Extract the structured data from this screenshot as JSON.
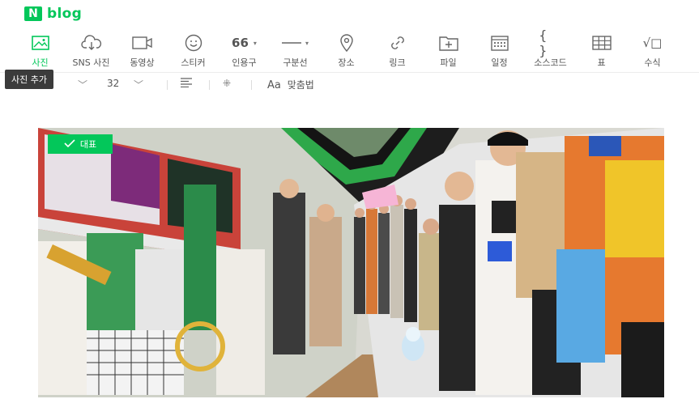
{
  "header": {
    "logo_letter": "N",
    "logo_text": "blog"
  },
  "toolbar": {
    "items": [
      {
        "label": "사진",
        "icon": "image-icon",
        "active": true
      },
      {
        "label": "SNS 사진",
        "icon": "cloud-download-icon"
      },
      {
        "label": "동영상",
        "icon": "video-icon"
      },
      {
        "label": "스티커",
        "icon": "smile-icon"
      },
      {
        "label": "인용구",
        "icon": "quote-icon",
        "glyph": "66"
      },
      {
        "label": "구분선",
        "icon": "divider-icon"
      },
      {
        "label": "장소",
        "icon": "location-icon"
      },
      {
        "label": "링크",
        "icon": "link-icon"
      },
      {
        "label": "파일",
        "icon": "file-add-icon"
      },
      {
        "label": "일정",
        "icon": "calendar-icon"
      },
      {
        "label": "소스코드",
        "icon": "code-icon",
        "glyph": "{ }"
      },
      {
        "label": "표",
        "icon": "table-icon"
      },
      {
        "label": "수식",
        "icon": "formula-icon",
        "glyph": "√□"
      }
    ],
    "accent_color": "#03c75a"
  },
  "tooltip": {
    "text": "사진 추가"
  },
  "formatbar": {
    "font_size": "32",
    "spellcheck_label": "맞춤법",
    "spellcheck_glyph": "Aa"
  },
  "photo": {
    "badge_label": "대표"
  }
}
